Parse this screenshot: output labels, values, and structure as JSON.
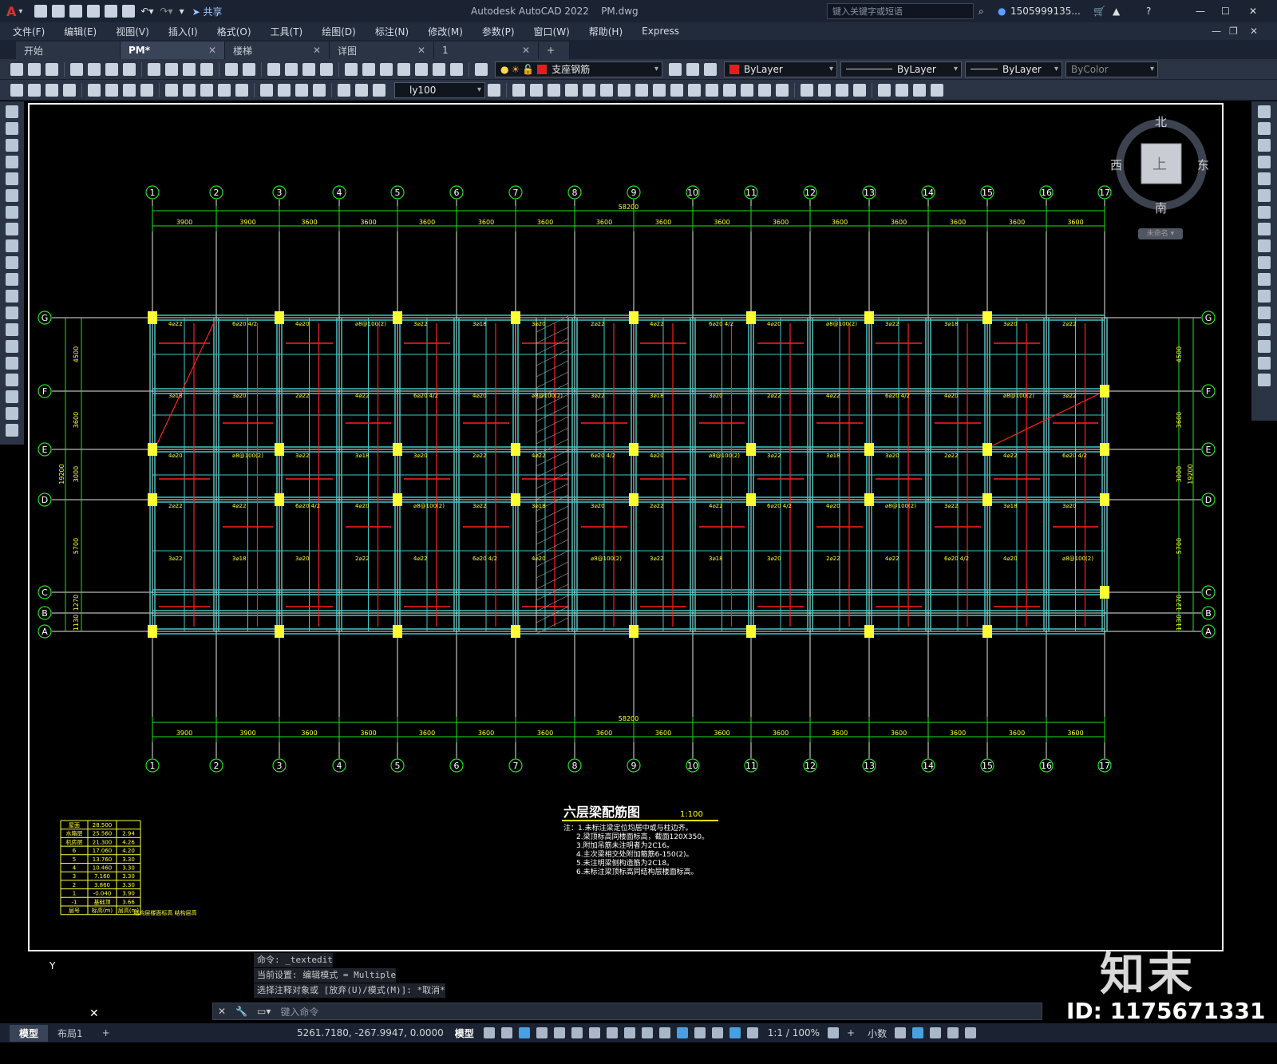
{
  "app": {
    "title": "Autodesk AutoCAD 2022",
    "file": "PM.dwg",
    "app_button": "A",
    "share_label": "共享",
    "search_placeholder": "键入关键字或短语",
    "user": "1505999135..."
  },
  "menus": [
    "文件(F)",
    "编辑(E)",
    "视图(V)",
    "插入(I)",
    "格式(O)",
    "工具(T)",
    "绘图(D)",
    "标注(N)",
    "修改(M)",
    "参数(P)",
    "窗口(W)",
    "帮助(H)",
    "Express"
  ],
  "doc_tabs": [
    {
      "label": "开始",
      "active": false
    },
    {
      "label": "PM*",
      "active": true
    },
    {
      "label": "楼梯",
      "active": false
    },
    {
      "label": "详图",
      "active": false
    },
    {
      "label": "1",
      "active": false
    }
  ],
  "properties": {
    "layer": "支座钢筋",
    "color": "ByLayer",
    "linetype": "ByLayer",
    "lineweight": "ByLayer",
    "plotstyle": "ByColor",
    "dimstyle": "ly100"
  },
  "viewcube": {
    "north": "北",
    "south": "南",
    "east": "东",
    "west": "西",
    "top": "上",
    "ucs": "未命名"
  },
  "drawing": {
    "grid_columns": [
      "1",
      "2",
      "3",
      "4",
      "5",
      "6",
      "7",
      "8",
      "9",
      "10",
      "11",
      "12",
      "13",
      "14",
      "15",
      "16",
      "17"
    ],
    "grid_rows": [
      "G",
      "F",
      "E",
      "D",
      "C",
      "B",
      "A"
    ],
    "col_spacings": [
      "3900",
      "3900",
      "3600",
      "3600",
      "3600",
      "3600",
      "3600",
      "3600",
      "3600",
      "3600",
      "3600",
      "3600",
      "3600",
      "3600",
      "3600",
      "3600"
    ],
    "total_length": "58200",
    "row_dims": [
      "4500",
      "3600",
      "3000",
      "5700",
      "1270",
      "1130"
    ],
    "total_width": "19200",
    "title": "六层梁配筋图",
    "scale": "1:100",
    "notes": [
      "注：1.未标注梁定位均居中或与柱边齐。",
      "2.梁顶标高同楼面标高，截面120X350。",
      "3.附加吊筋未注明者为2C16。",
      "4.主次梁相交处附加箍筋6-150(2)。",
      "5.未注明梁侧构造筋为2C18。",
      "6.未标注梁顶标高同结构层楼面标高。"
    ],
    "level_table": {
      "headers": [
        "层号",
        "标高(m)",
        "层高(m)"
      ],
      "rows": [
        [
          "屋面",
          "28.500",
          ""
        ],
        [
          "水箱层",
          "25.560",
          "2.94"
        ],
        [
          "机房层",
          "21.300",
          "4.26"
        ],
        [
          "6",
          "17.060",
          "4.20"
        ],
        [
          "5",
          "13.760",
          "3.30"
        ],
        [
          "4",
          "10.460",
          "3.30"
        ],
        [
          "3",
          "7.160",
          "3.30"
        ],
        [
          "2",
          "3.860",
          "3.30"
        ],
        [
          "1",
          "-0.040",
          "3.90"
        ],
        [
          "-1",
          "基础顶",
          "3.66"
        ]
      ],
      "caption": "结构层楼面标高 结构层高"
    }
  },
  "command": {
    "history": [
      "命令: _textedit",
      "当前设置: 编辑模式 = Multiple",
      "选择注释对象或 [放弃(U)/模式(M)]: *取消*"
    ],
    "prompt_placeholder": "键入命令"
  },
  "layout_tabs": [
    "模型",
    "布局1",
    "+"
  ],
  "status": {
    "coords": "5261.7180, -267.9947, 0.0000",
    "space": "模型",
    "scale": "1:1 / 100%",
    "units": "小数"
  },
  "watermark": {
    "brand": "知末",
    "id": "ID: 1175671331"
  }
}
